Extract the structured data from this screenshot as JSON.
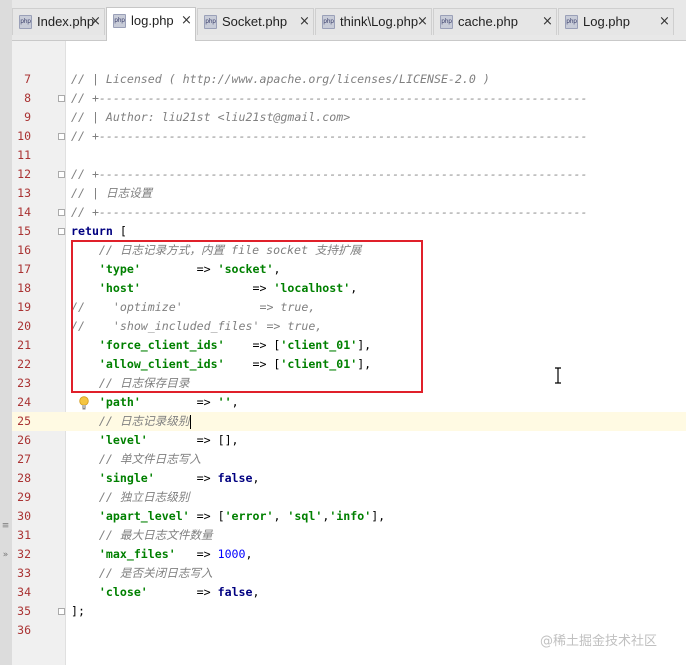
{
  "tabs": [
    {
      "label": "Index.php",
      "close": "×"
    },
    {
      "label": "log.php",
      "close": "×",
      "active": true
    },
    {
      "label": "Socket.php",
      "close": "×"
    },
    {
      "label": "think\\Log.php",
      "close": "×"
    },
    {
      "label": "cache.php",
      "close": "×"
    },
    {
      "label": "Log.php",
      "close": "×"
    }
  ],
  "tab_icon_text": "php",
  "left_strip_marks": [
    "≡",
    "»"
  ],
  "lines": [
    {
      "n": "7",
      "tokens": [
        {
          "c": "cm",
          "t": "// | Licensed ( http://www.apache.org/licenses/LICENSE-2.0 )"
        }
      ]
    },
    {
      "n": "8",
      "tokens": [
        {
          "c": "cm",
          "t": "// +----------------------------------------------------------------------"
        }
      ]
    },
    {
      "n": "9",
      "tokens": [
        {
          "c": "cm",
          "t": "// | Author: liu21st <liu21st@gmail.com>"
        }
      ]
    },
    {
      "n": "10",
      "tokens": [
        {
          "c": "cm",
          "t": "// +----------------------------------------------------------------------"
        }
      ]
    },
    {
      "n": "11",
      "tokens": []
    },
    {
      "n": "12",
      "tokens": [
        {
          "c": "cm",
          "t": "// +----------------------------------------------------------------------"
        }
      ]
    },
    {
      "n": "13",
      "tokens": [
        {
          "c": "cm",
          "t": "// | 日志设置"
        }
      ]
    },
    {
      "n": "14",
      "tokens": [
        {
          "c": "cm",
          "t": "// +----------------------------------------------------------------------"
        }
      ]
    },
    {
      "n": "15",
      "tokens": [
        {
          "c": "kw",
          "t": "return"
        },
        {
          "c": "op",
          "t": " ["
        }
      ]
    },
    {
      "n": "16",
      "tokens": [
        {
          "c": "cm",
          "t": "    // 日志记录方式，内置 file socket 支持扩展"
        }
      ]
    },
    {
      "n": "17",
      "tokens": [
        {
          "c": "op",
          "t": "    "
        },
        {
          "c": "str",
          "t": "'type'"
        },
        {
          "c": "op",
          "t": "        => "
        },
        {
          "c": "str",
          "t": "'socket'"
        },
        {
          "c": "op",
          "t": ","
        }
      ]
    },
    {
      "n": "18",
      "tokens": [
        {
          "c": "op",
          "t": "    "
        },
        {
          "c": "str",
          "t": "'host'"
        },
        {
          "c": "op",
          "t": "                => "
        },
        {
          "c": "str",
          "t": "'localhost'"
        },
        {
          "c": "op",
          "t": ","
        }
      ]
    },
    {
      "n": "19",
      "tokens": [
        {
          "c": "cm",
          "t": "//    'optimize'           => true,"
        }
      ]
    },
    {
      "n": "20",
      "tokens": [
        {
          "c": "cm",
          "t": "//    'show_included_files' => true,"
        }
      ]
    },
    {
      "n": "21",
      "tokens": [
        {
          "c": "op",
          "t": "    "
        },
        {
          "c": "str",
          "t": "'force_client_ids'"
        },
        {
          "c": "op",
          "t": "    => ["
        },
        {
          "c": "str",
          "t": "'client_01'"
        },
        {
          "c": "op",
          "t": "],"
        }
      ]
    },
    {
      "n": "22",
      "tokens": [
        {
          "c": "op",
          "t": "    "
        },
        {
          "c": "str",
          "t": "'allow_client_ids'"
        },
        {
          "c": "op",
          "t": "    => ["
        },
        {
          "c": "str",
          "t": "'client_01'"
        },
        {
          "c": "op",
          "t": "],"
        }
      ]
    },
    {
      "n": "23",
      "tokens": [
        {
          "c": "cm",
          "t": "    // 日志保存目录"
        }
      ]
    },
    {
      "n": "24",
      "tokens": [
        {
          "c": "op",
          "t": "    "
        },
        {
          "c": "str",
          "t": "'path'"
        },
        {
          "c": "op",
          "t": "        => "
        },
        {
          "c": "str",
          "t": "''"
        },
        {
          "c": "op",
          "t": ","
        }
      ]
    },
    {
      "n": "25",
      "tokens": [
        {
          "c": "cm",
          "t": "    // 日志记录级别"
        }
      ]
    },
    {
      "n": "26",
      "tokens": [
        {
          "c": "op",
          "t": "    "
        },
        {
          "c": "str",
          "t": "'level'"
        },
        {
          "c": "op",
          "t": "       => [],"
        }
      ]
    },
    {
      "n": "27",
      "tokens": [
        {
          "c": "cm",
          "t": "    // 单文件日志写入"
        }
      ]
    },
    {
      "n": "28",
      "tokens": [
        {
          "c": "op",
          "t": "    "
        },
        {
          "c": "str",
          "t": "'single'"
        },
        {
          "c": "op",
          "t": "      => "
        },
        {
          "c": "kw",
          "t": "false"
        },
        {
          "c": "op",
          "t": ","
        }
      ]
    },
    {
      "n": "29",
      "tokens": [
        {
          "c": "cm",
          "t": "    // 独立日志级别"
        }
      ]
    },
    {
      "n": "30",
      "tokens": [
        {
          "c": "op",
          "t": "    "
        },
        {
          "c": "str",
          "t": "'apart_level'"
        },
        {
          "c": "op",
          "t": " => ["
        },
        {
          "c": "str",
          "t": "'error'"
        },
        {
          "c": "op",
          "t": ", "
        },
        {
          "c": "str",
          "t": "'sql'"
        },
        {
          "c": "op",
          "t": ","
        },
        {
          "c": "str",
          "t": "'info'"
        },
        {
          "c": "op",
          "t": "],"
        }
      ]
    },
    {
      "n": "31",
      "tokens": [
        {
          "c": "cm",
          "t": "    // 最大日志文件数量"
        }
      ]
    },
    {
      "n": "32",
      "tokens": [
        {
          "c": "op",
          "t": "    "
        },
        {
          "c": "str",
          "t": "'max_files'"
        },
        {
          "c": "op",
          "t": "   => "
        },
        {
          "c": "num",
          "t": "1000"
        },
        {
          "c": "op",
          "t": ","
        }
      ]
    },
    {
      "n": "33",
      "tokens": [
        {
          "c": "cm",
          "t": "    // 是否关闭日志写入"
        }
      ]
    },
    {
      "n": "34",
      "tokens": [
        {
          "c": "op",
          "t": "    "
        },
        {
          "c": "str",
          "t": "'close'"
        },
        {
          "c": "op",
          "t": "       => "
        },
        {
          "c": "kw",
          "t": "false"
        },
        {
          "c": "op",
          "t": ","
        }
      ]
    },
    {
      "n": "35",
      "tokens": [
        {
          "c": "op",
          "t": "];"
        }
      ]
    },
    {
      "n": "36",
      "tokens": []
    }
  ],
  "watermark": "@稀土掘金技术社区",
  "colors": {
    "line_number": "#aa3333",
    "string": "#008000",
    "keyword": "#000080",
    "comment": "#808080",
    "number": "#0000ff",
    "highlight_box": "#e0202a"
  }
}
